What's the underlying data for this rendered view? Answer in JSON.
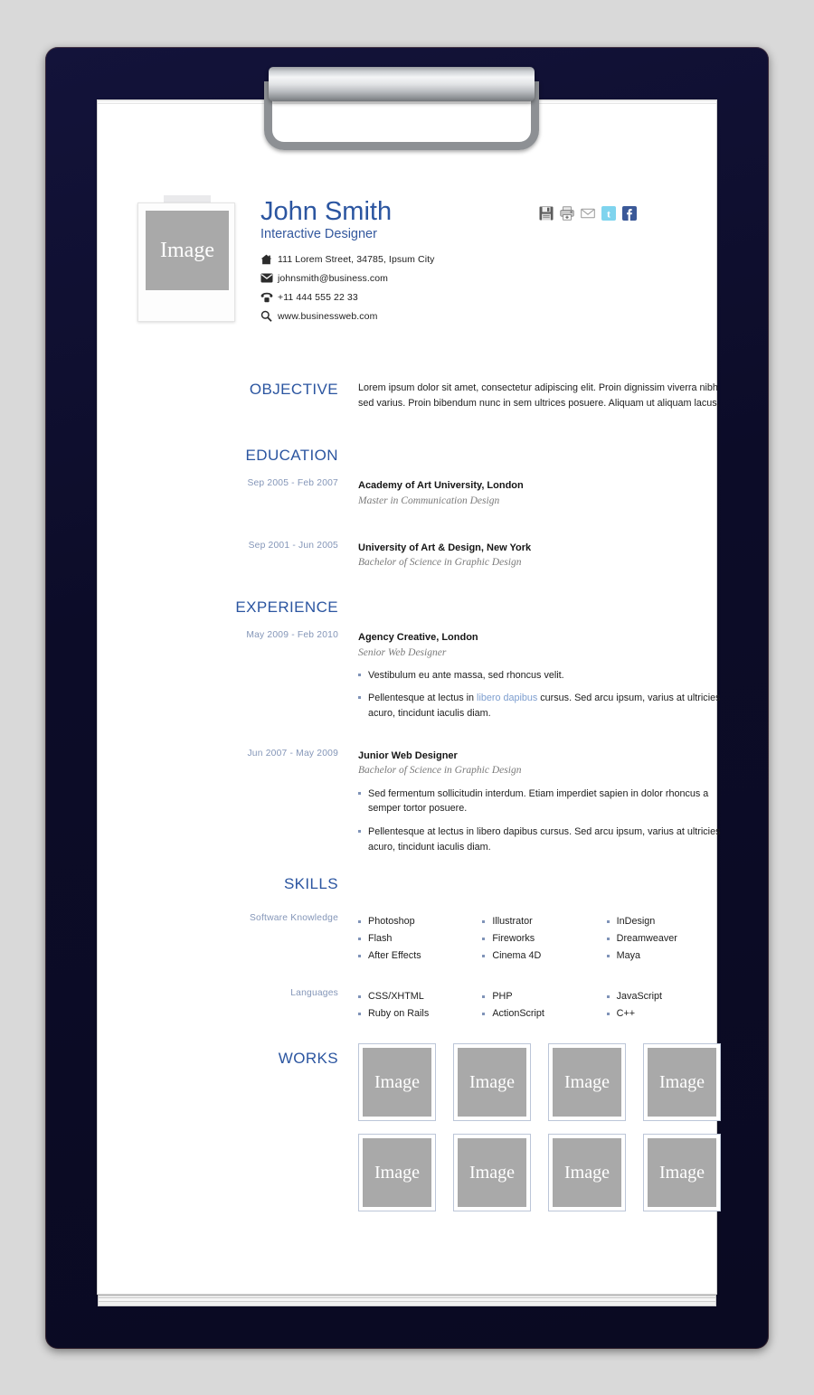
{
  "theme": {
    "board_color": "#0c0c28",
    "accent_blue": "#2b55a0",
    "muted_blue": "#8496b8",
    "link_blue": "#7d9ecf"
  },
  "header": {
    "photo_placeholder": "Image",
    "name": "John Smith",
    "job_title": "Interactive Designer",
    "contacts": [
      {
        "icon": "home-icon",
        "text": "111 Lorem Street, 34785, Ipsum City"
      },
      {
        "icon": "envelope-icon",
        "text": "johnsmith@business.com"
      },
      {
        "icon": "telephone-icon",
        "text": "+11 444 555 22 33"
      },
      {
        "icon": "magnifier-icon",
        "text": "www.businessweb.com"
      }
    ],
    "social": [
      {
        "icon": "save-icon",
        "label": "Save"
      },
      {
        "icon": "print-icon",
        "label": "Print"
      },
      {
        "icon": "email-icon",
        "label": "Email"
      },
      {
        "icon": "twitter-icon",
        "label": "Twitter"
      },
      {
        "icon": "facebook-icon",
        "label": "Facebook"
      }
    ]
  },
  "objective": {
    "heading": "OBJECTIVE",
    "text": "Lorem ipsum dolor sit amet, consectetur adipiscing elit. Proin dignissim viverra nibh sed varius. Proin bibendum nunc in sem ultrices posuere. Aliquam ut aliquam lacus."
  },
  "education": {
    "heading": "EDUCATION",
    "entries": [
      {
        "date": "Sep 2005 - Feb 2007",
        "title": "Academy of Art University, London",
        "subtitle": "Master in Communication Design"
      },
      {
        "date": "Sep 2001 - Jun 2005",
        "title": "University of Art & Design, New York",
        "subtitle": "Bachelor of Science in Graphic Design"
      }
    ]
  },
  "experience": {
    "heading": "EXPERIENCE",
    "entries": [
      {
        "date": "May 2009 - Feb 2010",
        "title": "Agency Creative, London",
        "subtitle": "Senior Web Designer",
        "bullets": [
          {
            "before": "Vestibulum eu ante massa, sed rhoncus velit.",
            "link": "",
            "after": ""
          },
          {
            "before": "Pellentesque at lectus in ",
            "link": "libero dapibus",
            "after": " cursus. Sed arcu ipsum, varius at ultricies acuro, tincidunt iaculis diam."
          }
        ]
      },
      {
        "date": "Jun 2007 - May 2009",
        "title": "Junior Web Designer",
        "subtitle": "Bachelor of Science in Graphic Design",
        "bullets": [
          {
            "before": "Sed fermentum sollicitudin interdum. Etiam imperdiet sapien in dolor rhoncus a semper tortor posuere.",
            "link": "",
            "after": ""
          },
          {
            "before": "Pellentesque at lectus in libero dapibus cursus. Sed arcu ipsum, varius at ultricies acuro, tincidunt iaculis diam.",
            "link": "",
            "after": ""
          }
        ]
      }
    ]
  },
  "skills": {
    "heading": "SKILLS",
    "groups": [
      {
        "label": "Software Knowledge",
        "columns": [
          [
            "Photoshop",
            "Flash",
            "After Effects"
          ],
          [
            "Illustrator",
            "Fireworks",
            "Cinema 4D"
          ],
          [
            "InDesign",
            "Dreamweaver",
            "Maya"
          ]
        ]
      },
      {
        "label": "Languages",
        "columns": [
          [
            "CSS/XHTML",
            "Ruby on Rails"
          ],
          [
            "PHP",
            "ActionScript"
          ],
          [
            "JavaScript",
            "C++"
          ]
        ]
      }
    ]
  },
  "works": {
    "heading": "WORKS",
    "items": [
      "Image",
      "Image",
      "Image",
      "Image",
      "Image",
      "Image",
      "Image",
      "Image"
    ]
  }
}
